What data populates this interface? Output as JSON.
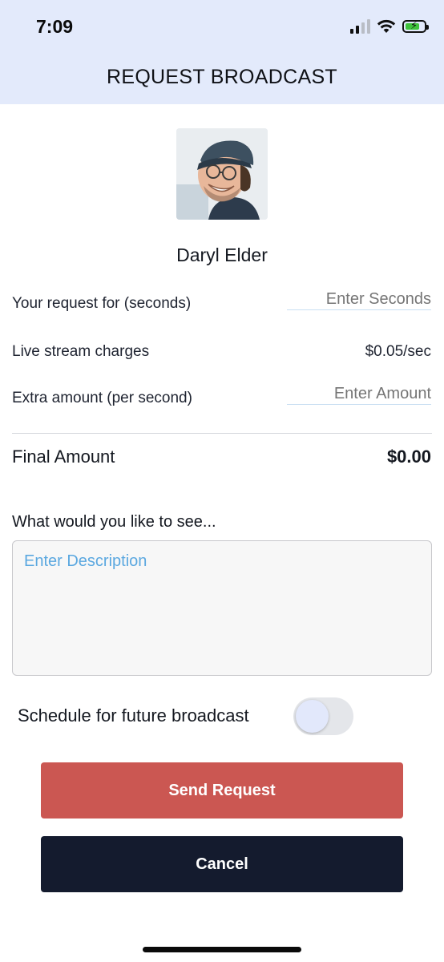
{
  "status_bar": {
    "time": "7:09",
    "icons": [
      "signal-icon",
      "wifi-icon",
      "battery-charging-icon"
    ]
  },
  "header": {
    "title": "REQUEST BROADCAST",
    "background": "#e3eafb"
  },
  "profile": {
    "name": "Daryl Elder"
  },
  "form": {
    "request_label": "Your request for (seconds)",
    "seconds_placeholder": "Enter Seconds",
    "charges_label": "Live stream charges",
    "charges_value": "$0.05/sec",
    "extra_label": "Extra amount (per second)",
    "amount_placeholder": "Enter Amount",
    "final_label": "Final Amount",
    "final_value": "$0.00",
    "description_label": "What would you like to see...",
    "description_placeholder": "Enter Description",
    "schedule_label": "Schedule for future broadcast",
    "schedule_enabled": false
  },
  "actions": {
    "send_label": "Send Request",
    "cancel_label": "Cancel"
  },
  "colors": {
    "accent_link": "#5ba8e0",
    "send_button": "#cb5752",
    "cancel_button": "#141b2e"
  }
}
